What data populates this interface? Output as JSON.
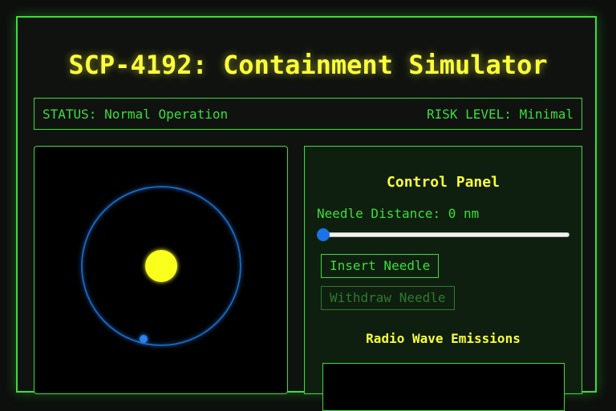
{
  "title": "SCP-4192: Containment Simulator",
  "status": {
    "status_text": "STATUS: Normal Operation",
    "risk_text": "RISK LEVEL: Minimal"
  },
  "control_panel": {
    "title": "Control Panel",
    "needle_label": "Needle Distance: 0 nm",
    "needle_value": 0,
    "insert_label": "Insert Needle",
    "withdraw_label": "Withdraw Needle",
    "radio_title": "Radio Wave Emissions"
  },
  "colors": {
    "accent": "#3ddc3d",
    "highlight": "#fbff3a",
    "slider": "#1a73e8",
    "orbit": "#1e6fd0"
  }
}
